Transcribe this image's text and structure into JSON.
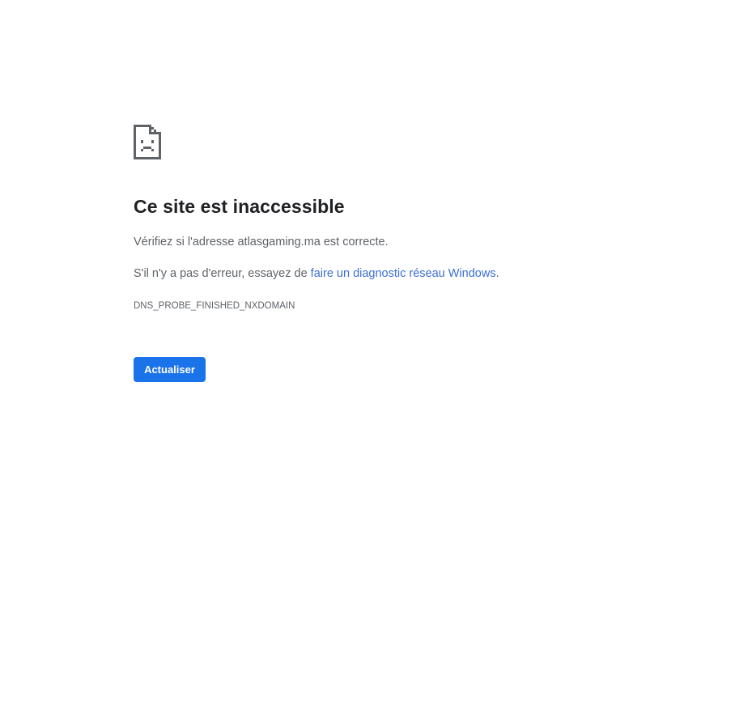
{
  "error_page": {
    "icon": "sad-page-icon",
    "title": "Ce site est inaccessible",
    "check_address": "Vérifiez si l'adresse atlasgaming.ma est correcte.",
    "suggestion_prefix": "S'il n'y a pas d'erreur, essayez de ",
    "diagnostic_link": "faire un diagnostic réseau Windows",
    "suggestion_suffix": ".",
    "error_code": "DNS_PROBE_FINISHED_NXDOMAIN",
    "reload_label": "Actualiser"
  },
  "colors": {
    "title": "#202124",
    "body_text": "#5f6368",
    "link": "#3c6fd3",
    "button": "#1a73e8",
    "button_text": "#ffffff"
  }
}
